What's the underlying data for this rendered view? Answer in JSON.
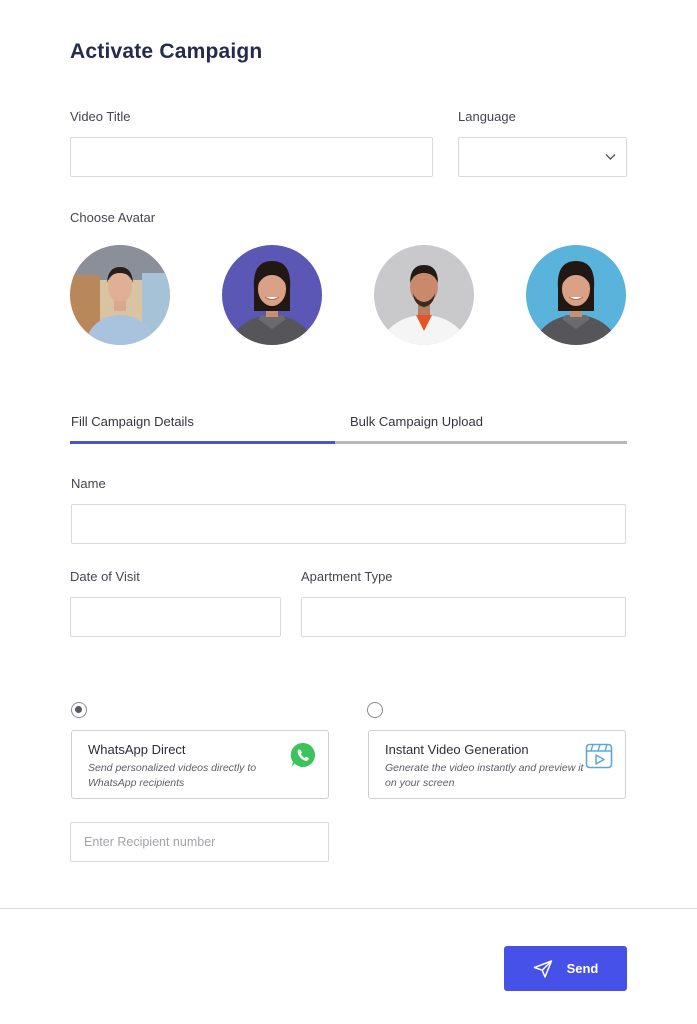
{
  "page": {
    "title": "Activate Campaign"
  },
  "form": {
    "video_title_label": "Video Title",
    "video_title_value": "",
    "language_label": "Language",
    "language_value": "",
    "choose_avatar_label": "Choose Avatar"
  },
  "avatars": [
    {
      "name": "avatar-woman-office",
      "bg": "#c8a57a"
    },
    {
      "name": "avatar-woman-purple",
      "bg": "#5a57b5"
    },
    {
      "name": "avatar-man-grey",
      "bg": "#c7c7c9"
    },
    {
      "name": "avatar-woman-blue",
      "bg": "#5ab3da"
    }
  ],
  "tabs": [
    {
      "label": "Fill Campaign Details",
      "active": true
    },
    {
      "label": "Bulk Campaign Upload",
      "active": false
    }
  ],
  "details": {
    "name_label": "Name",
    "name_value": "",
    "date_label": "Date of Visit",
    "date_value": "",
    "apartment_label": "Apartment Type",
    "apartment_value": ""
  },
  "delivery": {
    "options": [
      {
        "title": "WhatsApp Direct",
        "desc": "Send personalized videos directly to WhatsApp recipients",
        "selected": true,
        "icon": "whatsapp-icon"
      },
      {
        "title": "Instant Video Generation",
        "desc": "Generate the video instantly and preview it on your screen",
        "selected": false,
        "icon": "video-icon"
      }
    ],
    "recipient_placeholder": "Enter Recipient number"
  },
  "actions": {
    "send_label": "Send"
  },
  "colors": {
    "accent": "#4651e8",
    "tab_active": "#4a55c8",
    "tab_inactive": "#b8b8bd",
    "whatsapp": "#3cc35c",
    "video_icon": "#5ba8d6"
  }
}
